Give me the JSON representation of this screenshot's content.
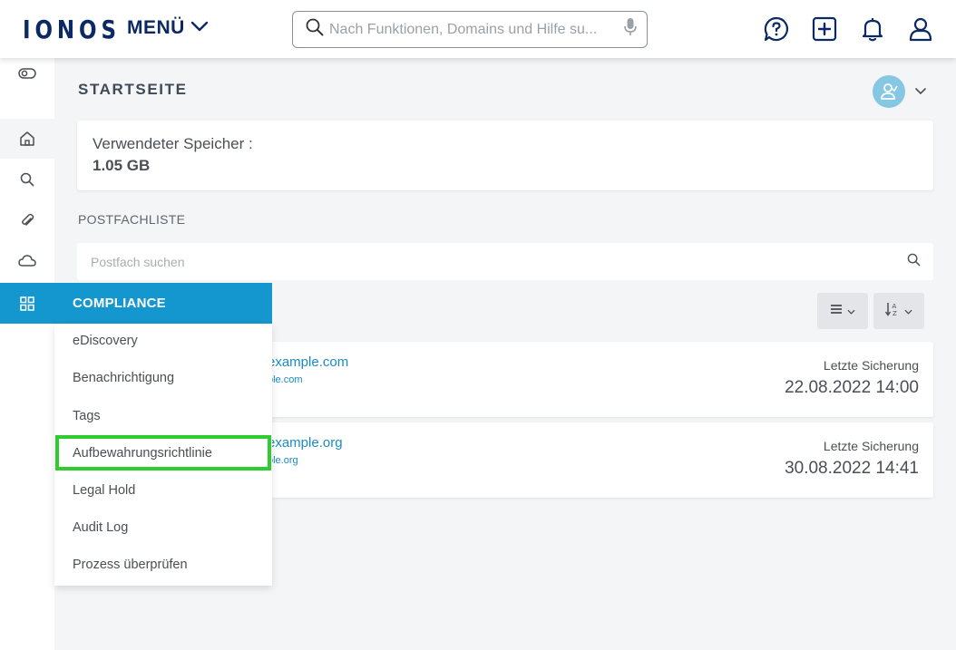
{
  "header": {
    "logo": "IONOS",
    "menu_label": "MENÜ",
    "search_placeholder": "Nach Funktionen, Domains und Hilfe su...",
    "icons": [
      "help-chat-icon",
      "add-icon",
      "bell-icon",
      "user-icon"
    ]
  },
  "rail": {
    "icons": [
      "toggle-icon",
      "home-icon",
      "search-icon",
      "paperclip-icon",
      "cloud-icon",
      "grid-icon"
    ]
  },
  "page": {
    "title": "STARTSEITE"
  },
  "storage": {
    "label": "Verwendeter Speicher :",
    "value": "1.05 GB"
  },
  "mailbox_list": {
    "label": "POSTFACHLISTE",
    "search_placeholder": "Postfach suchen",
    "items": [
      {
        "address": "example.com",
        "sub": "ple.com",
        "backup_label": "Letzte Sicherung",
        "backup_value": "22.08.2022 14:00"
      },
      {
        "address": "example.org",
        "sub": "ple.org",
        "backup_label": "Letzte Sicherung",
        "backup_value": "30.08.2022 14:41"
      }
    ]
  },
  "compliance": {
    "title": "COMPLIANCE",
    "items": [
      "eDiscovery",
      "Benachrichtigung",
      "Tags",
      "Aufbewahrungsrichtlinie",
      "Legal Hold",
      "Audit Log",
      "Prozess überprüfen"
    ],
    "highlighted": "Aufbewahrungsrichtlinie"
  },
  "colors": {
    "brand_navy": "#0b2a63",
    "accent_blue": "#1496cf",
    "link_blue": "#1a8bc4",
    "highlight_green": "#2ecc2e",
    "avatar_bg": "#86c7e4"
  }
}
